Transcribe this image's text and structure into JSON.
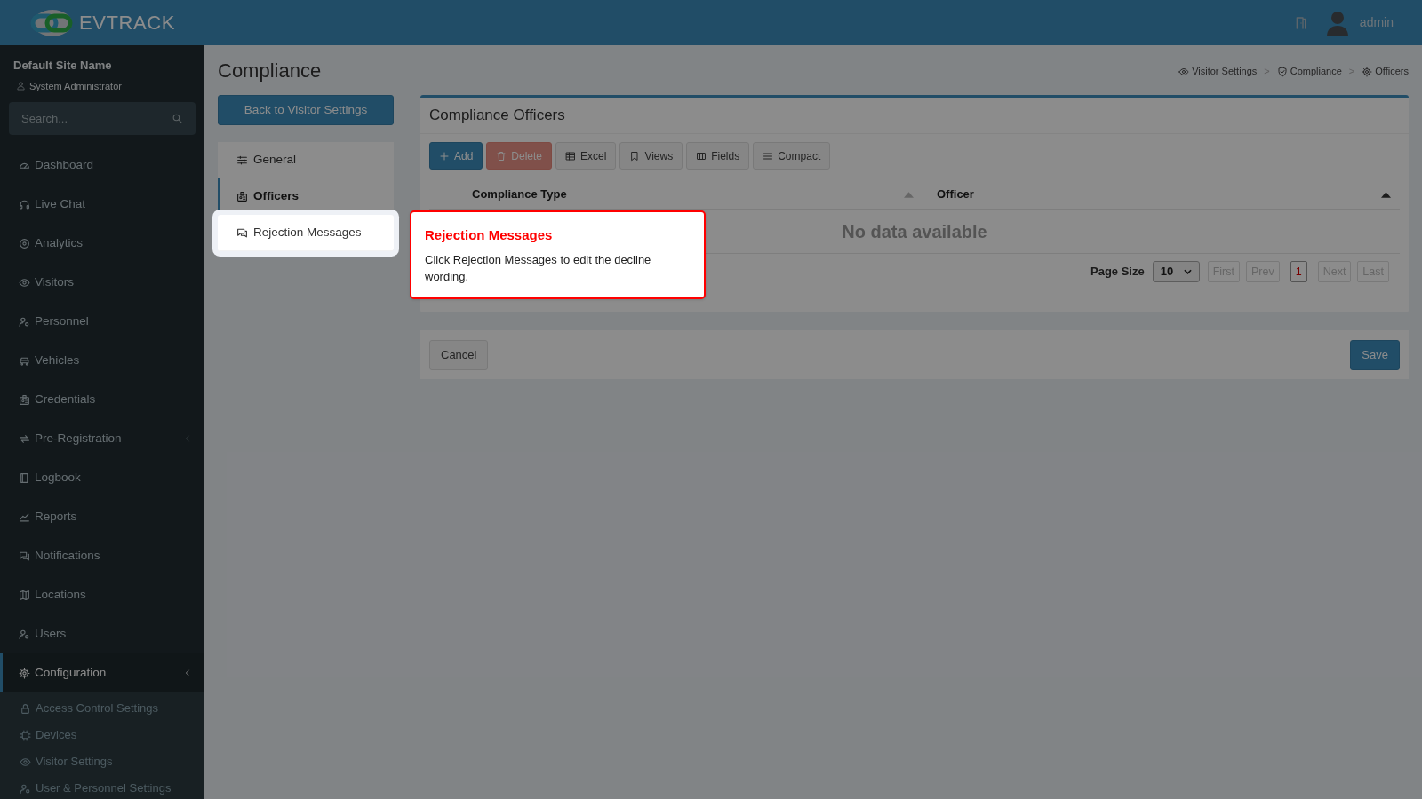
{
  "header": {
    "logo": "**EV**TRACK",
    "user": "admin"
  },
  "sidebar": {
    "site_name": "Default Site Name",
    "role": "System Administrator",
    "search": {
      "placeholder": "Search..."
    },
    "items": [
      {
        "label": "Dashboard",
        "selected": false
      },
      {
        "label": "Live Chat",
        "selected": false
      },
      {
        "label": "Analytics",
        "selected": false
      },
      {
        "label": "Visitors",
        "selected": false
      },
      {
        "label": "Personnel",
        "selected": false
      },
      {
        "label": "Vehicles",
        "selected": false
      },
      {
        "label": "Credentials",
        "selected": false
      },
      {
        "label": "Pre-Registration",
        "selected": false,
        "expanded": false
      },
      {
        "label": "Logbook",
        "selected": false
      },
      {
        "label": "Reports",
        "selected": false
      },
      {
        "label": "Notifications",
        "selected": false
      },
      {
        "label": "Locations",
        "selected": false
      },
      {
        "label": "Users",
        "selected": false
      },
      {
        "label": "Configuration",
        "selected": true,
        "expanded": true,
        "children": [
          {
            "label": "Access Control Settings",
            "selected": false
          },
          {
            "label": "Devices",
            "selected": false
          },
          {
            "label": "Visitor Settings",
            "selected": false
          },
          {
            "label": "User & Personnel Settings",
            "selected": false
          }
        ]
      }
    ]
  },
  "page": {
    "title": "Compliance",
    "breadcrumbs": [
      "Visitor Settings",
      "Compliance",
      "Officers"
    ],
    "breadcrumb_separator": ">",
    "back_button": "Back to Visitor Settings",
    "settings_nav": [
      {
        "label": "General",
        "selected": false,
        "highlighted": false
      },
      {
        "label": "Officers",
        "selected": true,
        "highlighted": false
      },
      {
        "label": "Rejection Messages",
        "selected": false,
        "highlighted": true
      }
    ],
    "tour": {
      "title": "Rejection Messages",
      "text": "Click Rejection Messages to edit the decline wording."
    },
    "panel": {
      "title": "Compliance Officers",
      "toolbar": [
        {
          "label": "Add",
          "kind": "primary"
        },
        {
          "label": "Delete",
          "kind": "danger"
        },
        {
          "label": "Excel",
          "kind": "default"
        },
        {
          "label": "Views",
          "kind": "default"
        },
        {
          "label": "Fields",
          "kind": "default"
        },
        {
          "label": "Compact",
          "kind": "default"
        }
      ],
      "columns": [
        {
          "label": "Compliance Type",
          "sorted": false
        },
        {
          "label": "Officer",
          "sorted": true
        }
      ],
      "empty_message": "No data available",
      "page_size_label": "Page Size",
      "page_size": "10",
      "pagination": [
        {
          "label": "First",
          "disabled": true,
          "selected": false
        },
        {
          "label": "Prev",
          "disabled": true,
          "selected": false
        },
        {
          "label": "1",
          "disabled": false,
          "selected": true
        },
        {
          "label": "Next",
          "disabled": true,
          "selected": false
        },
        {
          "label": "Last",
          "disabled": true,
          "selected": false
        }
      ]
    },
    "footer": {
      "cancel": "Cancel",
      "save": "Save"
    }
  }
}
